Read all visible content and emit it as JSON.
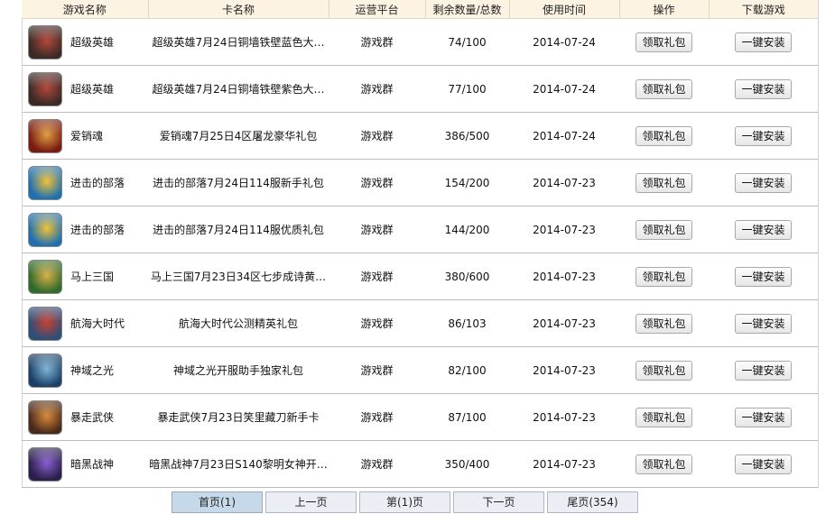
{
  "table": {
    "headers": [
      "游戏名称",
      "卡名称",
      "运营平台",
      "剩余数量/总数",
      "使用时间",
      "操作",
      "下载游戏"
    ],
    "rows": [
      {
        "game": "超级英雄",
        "card": "超级英雄7月24日铜墙铁壁蓝色大…",
        "platform": "游戏群",
        "count": "74/100",
        "date": "2014-07-24",
        "action": "领取礼包",
        "download": "一键安装",
        "icon": "superhero-game-icon",
        "icon_colors": [
          "#3a2a26",
          "#b3473a"
        ]
      },
      {
        "game": "超级英雄",
        "card": "超级英雄7月24日铜墙铁壁紫色大…",
        "platform": "游戏群",
        "count": "77/100",
        "date": "2014-07-24",
        "action": "领取礼包",
        "download": "一键安装",
        "icon": "superhero-game-icon",
        "icon_colors": [
          "#3a2a26",
          "#b3473a"
        ]
      },
      {
        "game": "爱销魂",
        "card": "爱销魂7月25日4区屠龙豪华礼包",
        "platform": "游戏群",
        "count": "386/500",
        "date": "2014-07-24",
        "action": "领取礼包",
        "download": "一键安装",
        "icon": "aixiaohun-game-icon",
        "icon_colors": [
          "#7a1b12",
          "#e0a040"
        ]
      },
      {
        "game": "进击的部落",
        "card": "进击的部落7月24日114服新手礼包",
        "platform": "游戏群",
        "count": "154/200",
        "date": "2014-07-23",
        "action": "领取礼包",
        "download": "一键安装",
        "icon": "tribe-game-icon",
        "icon_colors": [
          "#1d6fb3",
          "#f2c230"
        ]
      },
      {
        "game": "进击的部落",
        "card": "进击的部落7月24日114服优质礼包",
        "platform": "游戏群",
        "count": "144/200",
        "date": "2014-07-23",
        "action": "领取礼包",
        "download": "一键安装",
        "icon": "tribe-game-icon",
        "icon_colors": [
          "#1d6fb3",
          "#f2c230"
        ]
      },
      {
        "game": "马上三国",
        "card": "马上三国7月23日34区七步成诗黄…",
        "platform": "游戏群",
        "count": "380/600",
        "date": "2014-07-23",
        "action": "领取礼包",
        "download": "一键安装",
        "icon": "three-kingdoms-game-icon",
        "icon_colors": [
          "#2f6b2a",
          "#d9b04a"
        ]
      },
      {
        "game": "航海大时代",
        "card": "航海大时代公测精英礼包",
        "platform": "游戏群",
        "count": "86/103",
        "date": "2014-07-23",
        "action": "领取礼包",
        "download": "一键安装",
        "icon": "pirate-game-icon",
        "icon_colors": [
          "#2b4f7a",
          "#c8402f"
        ]
      },
      {
        "game": "神域之光",
        "card": "神域之光开服助手独家礼包",
        "platform": "游戏群",
        "count": "82/100",
        "date": "2014-07-23",
        "action": "领取礼包",
        "download": "一键安装",
        "icon": "divine-light-game-icon",
        "icon_colors": [
          "#1c3f66",
          "#7fb6d8"
        ]
      },
      {
        "game": "暴走武侠",
        "card": "暴走武侠7月23日笑里藏刀新手卡",
        "platform": "游戏群",
        "count": "87/100",
        "date": "2014-07-23",
        "action": "领取礼包",
        "download": "一键安装",
        "icon": "wuxia-game-icon",
        "icon_colors": [
          "#4a2a1a",
          "#d98a3a"
        ]
      },
      {
        "game": "暗黑战神",
        "card": "暗黑战神7月23日S140黎明女神开…",
        "platform": "游戏群",
        "count": "350/400",
        "date": "2014-07-23",
        "action": "领取礼包",
        "download": "一键安装",
        "icon": "dark-god-game-icon",
        "icon_colors": [
          "#2a1f4a",
          "#8a5fd0"
        ]
      }
    ]
  },
  "pagination": {
    "first": "首页(1)",
    "prev": "上一页",
    "current": "第(1)页",
    "next": "下一页",
    "last": "尾页(354)"
  }
}
